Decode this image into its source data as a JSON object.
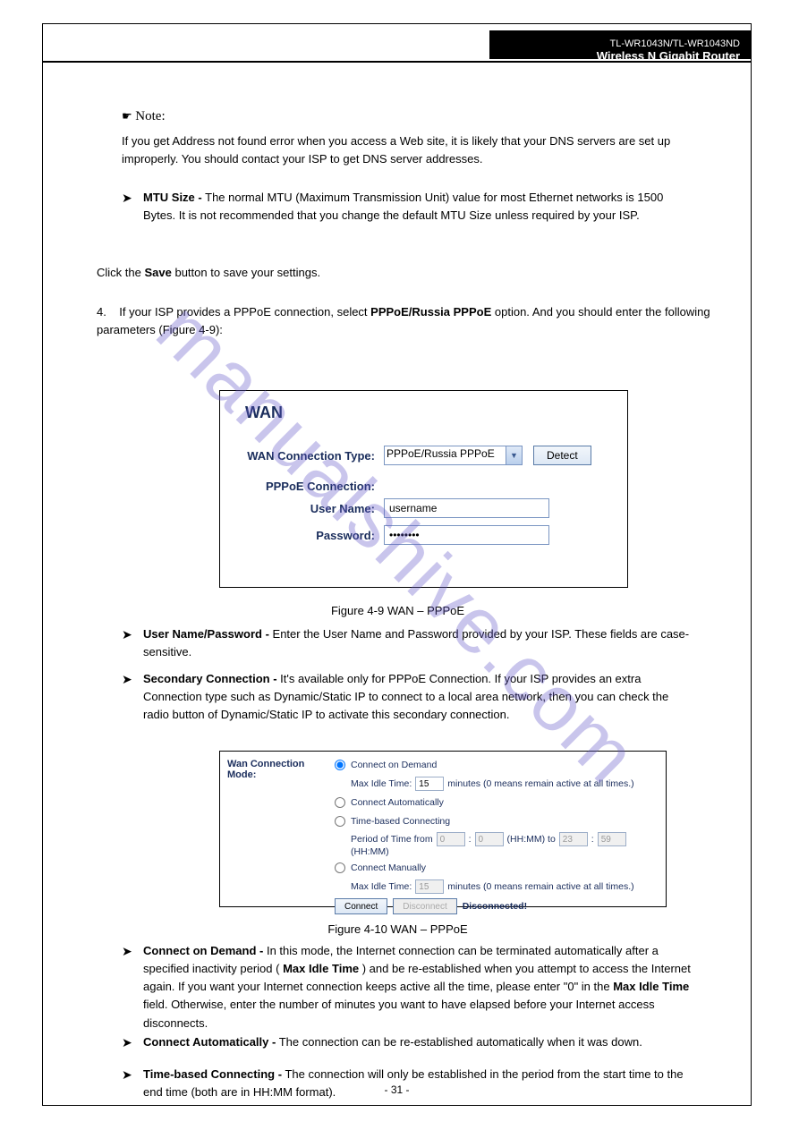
{
  "header": {
    "model": "TL-WR1043N/TL-WR1043ND",
    "product": "Wireless N Gigabit Router"
  },
  "watermark": "manualshive.com",
  "note1": {
    "label": "Note:",
    "text": "If you get Address not found error when you access a Web site, it is likely that your DNS servers are set up improperly. You should contact your ISP to get DNS server addresses."
  },
  "mtu_bullet": {
    "label": "MTU Size -",
    "text": "The normal MTU (Maximum Transmission Unit) value for most Ethernet networks is 1500 Bytes. It is not recommended that you change the default MTU Size unless required by your ISP."
  },
  "save_prompt": {
    "prefix": "Click the ",
    "btn": "Save",
    "suffix": " button to save your settings."
  },
  "pppoe_choice": {
    "ord": "4.",
    "prefix": "If your ISP provides a PPPoE connection, select ",
    "opt": "PPPoE/Russia PPPoE",
    "suffix": " option. And you should enter the following parameters (Figure 4-9):"
  },
  "fig49": {
    "title": "WAN",
    "conn_type_label": "WAN Connection Type:",
    "conn_type_value": "PPPoE/Russia PPPoE",
    "detect_btn": "Detect",
    "pppoe_section": "PPPoE Connection:",
    "user_label": "User Name:",
    "user_value": "username",
    "pass_label": "Password:",
    "pass_value": "••••••••",
    "caption": "Figure 4-9  WAN – PPPoE"
  },
  "user_pass_bullet": {
    "label": "User Name/Password -",
    "text": "Enter the User Name and Password provided by your ISP. These fields are case-sensitive."
  },
  "secondary_conn": {
    "label": "Secondary Connection -",
    "text": "It's available only for PPPoE Connection. If your ISP provides an extra Connection type such as Dynamic/Static IP to connect to a local area network, then you can check the radio button of Dynamic/Static IP to activate this secondary connection."
  },
  "fig410": {
    "lbl": "Wan Connection Mode:",
    "opt1": "Connect on Demand",
    "max_idle_lbl": "Max Idle Time:",
    "max_idle_val1": "15",
    "minutes_hint": "minutes (0 means remain active at all times.)",
    "opt2": "Connect Automatically",
    "opt3": "Time-based Connecting",
    "period_prefix": "Period of Time from",
    "h1": "0",
    "m1": "0",
    "hhmm_to": "(HH:MM) to",
    "h2": "23",
    "m2": "59",
    "hhmm": "(HH:MM)",
    "opt4": "Connect Manually",
    "max_idle_val2": "15",
    "connect_btn": "Connect",
    "disconnect_btn": "Disconnect",
    "status": "Disconnected!",
    "caption": "Figure 4-10  WAN – PPPoE"
  },
  "connect_on_demand": {
    "label": "Connect on Demand -",
    "text": "In this mode, the Internet connection can be terminated automatically after a specified inactivity period (",
    "emph": "Max Idle Time",
    "text2": ") and be re-established when you attempt to access the Internet again. If you want your Internet connection keeps active all the time, please enter \"0\" in the ",
    "emph2": "Max Idle Time",
    "text3": " field. Otherwise, enter the number of minutes you want to have elapsed before your Internet access disconnects."
  },
  "connect_auto": {
    "label": "Connect Automatically -",
    "text": "The connection can be re-established automatically when it was down."
  },
  "time_based": {
    "label": "Time-based Connecting -",
    "text": "The connection will only be established in the period from the start time to the end time (both are in HH:MM format)."
  },
  "page_number": "- 31 -"
}
